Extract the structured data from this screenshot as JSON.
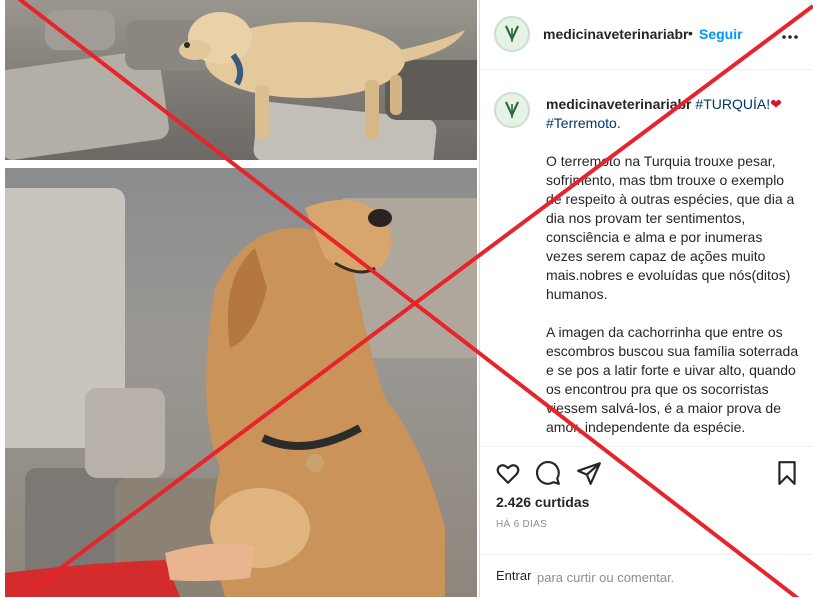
{
  "header": {
    "username": "medicinaveterinariabr",
    "separator": "•",
    "follow_label": "Seguir",
    "more_icon": "more-options-icon"
  },
  "caption": {
    "username": "medicinaveterinariabr",
    "hashtag_1": "#TURQUÍA!",
    "heart_emoji": "❤",
    "hashtag_2": "#Terremoto",
    "hashtag_2_suffix": ".",
    "paragraph_1": "O terremoto na Turquia trouxe pesar, sofrimento, mas tbm trouxe o exemplo de respeito à outras espécies, que dia a dia nos provam ter sentimentos, consciência e alma e por inumeras vezes serem capaz de ações muito mais.nobres e evoluídas que nós(ditos) humanos.",
    "paragraph_2": "A imagen da cachorrinha que entre os escombros buscou sua família soterrada e se pos a latir forte e uivar alto, quando os encontrou pra que os socorristas viessem salvá-los, é a maior prova de amor, independente da espécie."
  },
  "actions": {
    "icons": [
      "heart-icon",
      "comment-icon",
      "share-icon",
      "bookmark-icon"
    ],
    "likes": "2.426 curtidas",
    "time": "HÁ 6 DIAS"
  },
  "comment": {
    "prefix": "Entrar",
    "placeholder": "para curtir ou comentar."
  },
  "colors": {
    "accent": "#0095f6",
    "text": "#262626",
    "muted": "#8e8e8e",
    "cross": "#e8242b",
    "dog_fur": "#c9935a"
  }
}
